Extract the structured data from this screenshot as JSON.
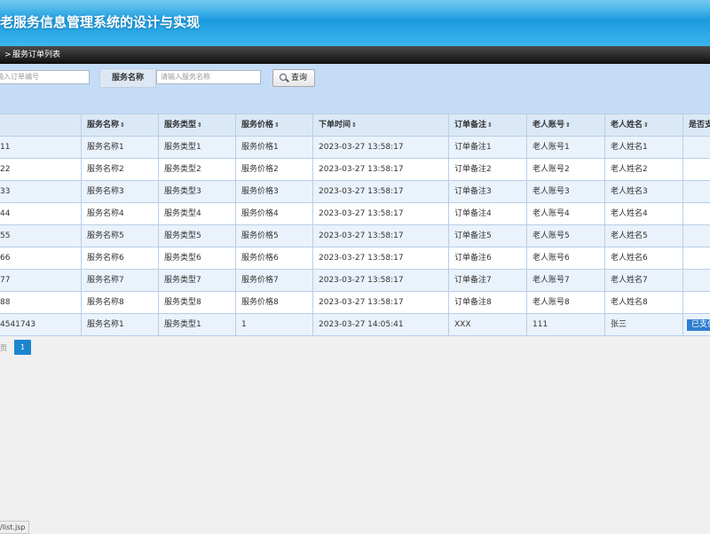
{
  "header": {
    "title": "老服务信息管理系统的设计与实现"
  },
  "breadcrumb": {
    "separator": ">",
    "current": "服务订单列表"
  },
  "search": {
    "order_input": {
      "placeholder": "输入订单编号"
    },
    "name_label": "服务名称",
    "name_input": {
      "placeholder": "请输入服务名称"
    },
    "query_button": "查询"
  },
  "table": {
    "columns": [
      "",
      "服务名称",
      "服务类型",
      "服务价格",
      "下单时间",
      "订单备注",
      "老人账号",
      "老人姓名",
      "是否支"
    ],
    "sort_indicator": "⇕",
    "rows": [
      [
        "11",
        "服务名称1",
        "服务类型1",
        "服务价格1",
        "2023-03-27 13:58:17",
        "订单备注1",
        "老人账号1",
        "老人姓名1",
        ""
      ],
      [
        "22",
        "服务名称2",
        "服务类型2",
        "服务价格2",
        "2023-03-27 13:58:17",
        "订单备注2",
        "老人账号2",
        "老人姓名2",
        ""
      ],
      [
        "33",
        "服务名称3",
        "服务类型3",
        "服务价格3",
        "2023-03-27 13:58:17",
        "订单备注3",
        "老人账号3",
        "老人姓名3",
        ""
      ],
      [
        "44",
        "服务名称4",
        "服务类型4",
        "服务价格4",
        "2023-03-27 13:58:17",
        "订单备注4",
        "老人账号4",
        "老人姓名4",
        ""
      ],
      [
        "55",
        "服务名称5",
        "服务类型5",
        "服务价格5",
        "2023-03-27 13:58:17",
        "订单备注5",
        "老人账号5",
        "老人姓名5",
        ""
      ],
      [
        "66",
        "服务名称6",
        "服务类型6",
        "服务价格6",
        "2023-03-27 13:58:17",
        "订单备注6",
        "老人账号6",
        "老人姓名6",
        ""
      ],
      [
        "77",
        "服务名称7",
        "服务类型7",
        "服务价格7",
        "2023-03-27 13:58:17",
        "订单备注7",
        "老人账号7",
        "老人姓名7",
        ""
      ],
      [
        "88",
        "服务名称8",
        "服务类型8",
        "服务价格8",
        "2023-03-27 13:58:17",
        "订单备注8",
        "老人账号8",
        "老人姓名8",
        ""
      ],
      [
        "4541743",
        "服务名称1",
        "服务类型1",
        "1",
        "2023-03-27 14:05:41",
        "XXX",
        "111",
        "张三",
        "已支付"
      ]
    ]
  },
  "pager": {
    "prefix": "页",
    "current_page": "1"
  },
  "status_bar": {
    "url": "/list.jsp"
  },
  "colors": {
    "header_blue": "#1d9be0",
    "paid_badge": "#2e7ed1",
    "pager_active": "#1b86cf"
  }
}
